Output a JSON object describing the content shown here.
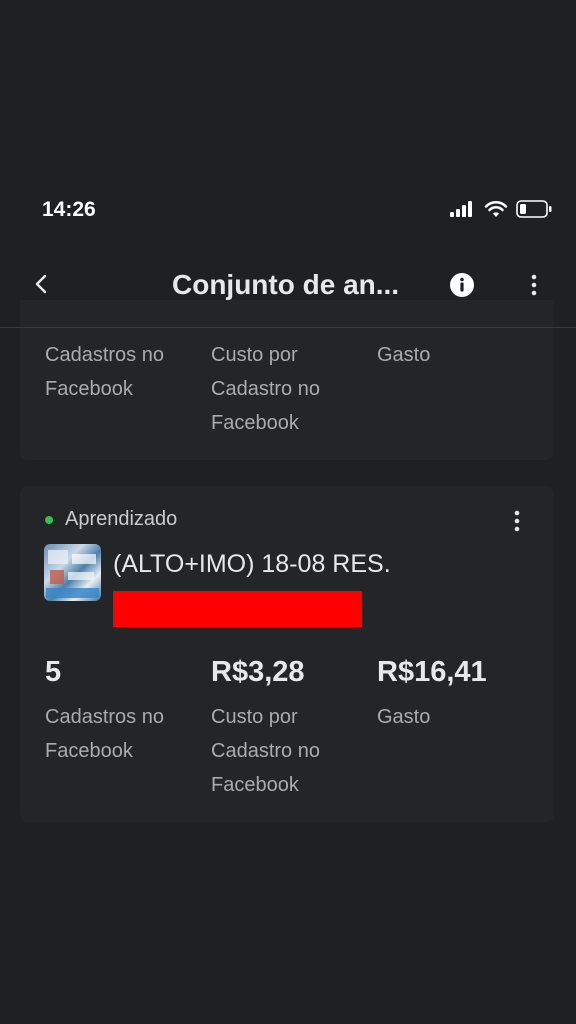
{
  "status_bar": {
    "time": "14:26",
    "icons": [
      "signal-icon",
      "wifi-icon",
      "battery-icon"
    ]
  },
  "nav": {
    "title": "Conjunto de an...",
    "back_icon": "chevron-left-icon",
    "info_icon": "info-icon",
    "more_icon": "more-vertical-icon"
  },
  "top_card": {
    "metrics": [
      {
        "label": "Cadastros no Facebook"
      },
      {
        "label": "Custo por Cadastro no Facebook"
      },
      {
        "label": "Gasto"
      }
    ]
  },
  "main_card": {
    "status": "Aprendizado",
    "ad_name": "(ALTO+IMO) 18-08 RES.",
    "metrics": [
      {
        "value": "5",
        "label": "Cadastros no Facebook"
      },
      {
        "value": "R$3,28",
        "label": "Custo por Cadastro no Facebook"
      },
      {
        "value": "R$16,41",
        "label": "Gasto"
      }
    ]
  },
  "colors": {
    "background": "#1f2022",
    "card": "#242526",
    "status_dot": "#2fc153",
    "redaction": "#ff0000"
  }
}
